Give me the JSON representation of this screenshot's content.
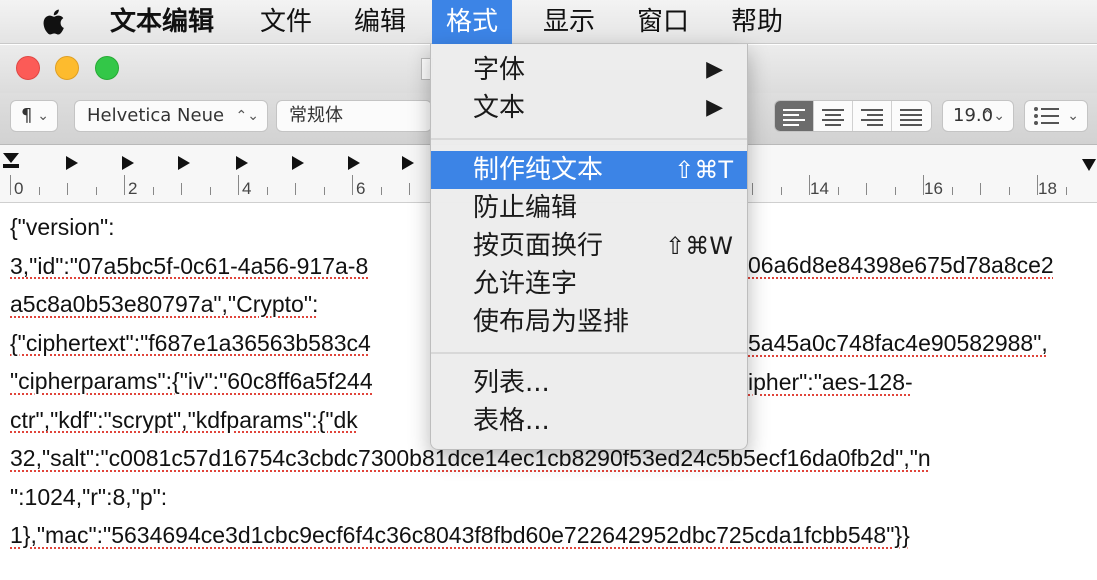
{
  "menubar": {
    "app_name": "文本编辑",
    "items": [
      "文件",
      "编辑",
      "格式",
      "显示",
      "窗口",
      "帮助"
    ],
    "active_item": "格式"
  },
  "toolbar": {
    "paragraph_style": "¶",
    "font_family": "Helvetica Neue",
    "font_style": "常规体",
    "font_size": "19.0",
    "chevron": "⌃⌄"
  },
  "ruler": {
    "numbers": [
      "0",
      "2",
      "4",
      "6",
      "14",
      "16",
      "18"
    ]
  },
  "format_menu": {
    "font": "字体",
    "text": "文本",
    "make_plain_text": "制作纯文本",
    "make_plain_text_shortcut": "⇧⌘T",
    "prevent_editing": "防止编辑",
    "wrap_to_page": "按页面换行",
    "wrap_to_page_shortcut": "⇧⌘W",
    "allow_ligatures": "允许连字",
    "vertical_layout": "使布局为竖排",
    "list": "列表...",
    "table": "表格...",
    "submenu_arrow": "▶"
  },
  "document": {
    "lines": [
      "{\"version\":",
      "3,\"id\":\"07a5bc5f-0c61-4a56-917a-8",
      "a5c8a0b53e80797a\",\"Crypto\":",
      "{\"ciphertext\":\"f687e1a36563b583c4",
      "\"cipherparams\":{\"iv\":\"60c8ff6a5f244",
      "ctr\",\"kdf\":\"scrypt\",\"kdfparams\":{\"dk",
      "32,\"salt\":\"c0081c57d16754c3cbdc7300b81dce14ec1cb8290f53ed24c5b5ecf16da0fb2d\",\"n",
      "\":1024,\"r\":8,\"p\":",
      "1},\"mac\":\"5634694ce3d1cbc9ecf6f4c36c8043f8fbd60e722642952dbc725cda1fcbb548\"}}"
    ],
    "right_fragments": {
      "line2": "06a6d8e84398e675d78a8ce2",
      "line4": "5a45a0c748fac4e90582988\",",
      "line5": "ipher\":\"aes-128-"
    }
  }
}
